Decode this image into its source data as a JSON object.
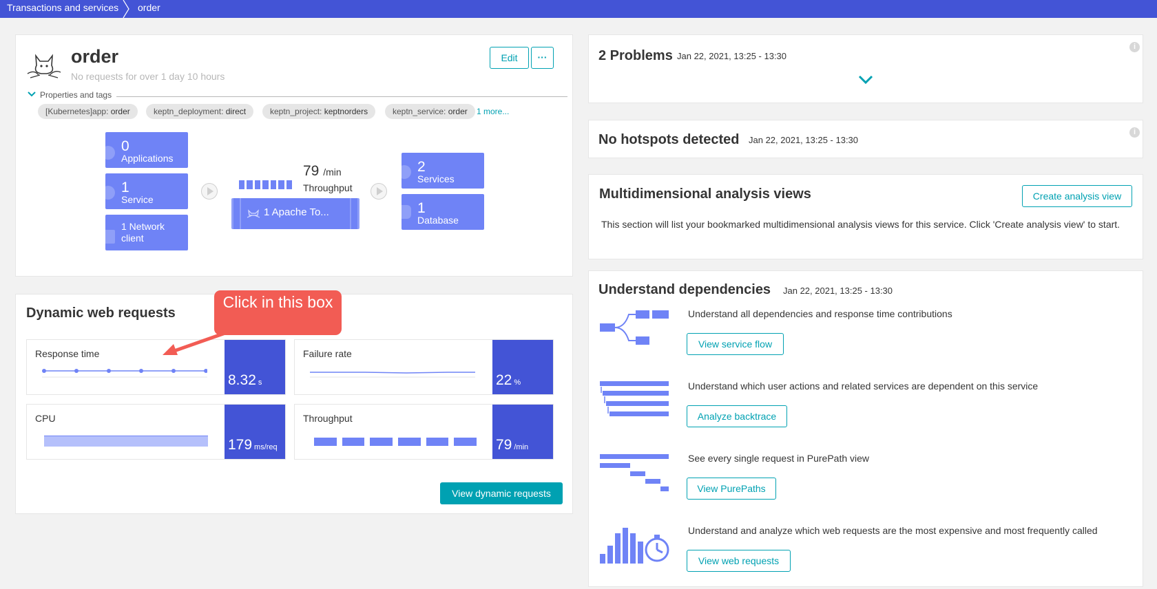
{
  "breadcrumb": {
    "parent": "Transactions and services",
    "current": "order"
  },
  "service": {
    "name": "order",
    "subtitle": "No requests for over 1 day 10 hours",
    "edit_label": "Edit",
    "more_label": "···",
    "properties_label": "Properties and tags",
    "tags": [
      {
        "key": "[Kubernetes]app:",
        "value": "order"
      },
      {
        "key": "keptn_deployment:",
        "value": "direct"
      },
      {
        "key": "keptn_project:",
        "value": "keptnorders"
      },
      {
        "key": "keptn_service:",
        "value": "order"
      }
    ],
    "more_tags": "1 more..."
  },
  "flow": {
    "callers": [
      {
        "num": "0",
        "label": "Applications"
      },
      {
        "num": "1",
        "label": "Service"
      },
      {
        "label": "1 Network client"
      }
    ],
    "throughput_value": "79",
    "throughput_unit": "/min",
    "throughput_label": "Throughput",
    "process_label": "1 Apache To...",
    "callees": [
      {
        "num": "2",
        "label": "Services"
      },
      {
        "num": "1",
        "label": "Database"
      }
    ]
  },
  "dynamic": {
    "title": "Dynamic web requests",
    "callout": "Click in this box",
    "metrics": [
      {
        "label": "Response time",
        "value": "8.32",
        "unit": "s"
      },
      {
        "label": "Failure rate",
        "value": "22",
        "unit": "%"
      },
      {
        "label": "CPU",
        "value": "179",
        "unit": "ms/req"
      },
      {
        "label": "Throughput",
        "value": "79",
        "unit": "/min"
      }
    ],
    "button": "View dynamic requests"
  },
  "problems": {
    "title": "2 Problems",
    "time": "Jan 22, 2021, 13:25 - 13:30"
  },
  "hotspots": {
    "title": "No hotspots detected",
    "time": "Jan 22, 2021, 13:25 - 13:30"
  },
  "mda": {
    "title": "Multidimensional analysis views",
    "button": "Create analysis view",
    "text": "This section will list your bookmarked multidimensional analysis views for this service. Click 'Create analysis view' to start."
  },
  "deps": {
    "title": "Understand dependencies",
    "time": "Jan 22, 2021, 13:25 - 13:30",
    "items": [
      {
        "text": "Understand all dependencies and response time contributions",
        "button": "View service flow",
        "icon": "service-flow-icon"
      },
      {
        "text": "Understand which user actions and related services are dependent on this service",
        "button": "Analyze backtrace",
        "icon": "backtrace-icon"
      },
      {
        "text": "See every single request in PurePath view",
        "button": "View PurePaths",
        "icon": "purepath-icon"
      },
      {
        "text": "Understand and analyze which web requests are the most expensive and most frequently called",
        "button": "View web requests",
        "icon": "web-requests-icon"
      }
    ]
  },
  "colors": {
    "brand": "#4354d6",
    "accent": "#00a1b2",
    "tile": "#6f83f6",
    "callout": "#f25c54"
  }
}
